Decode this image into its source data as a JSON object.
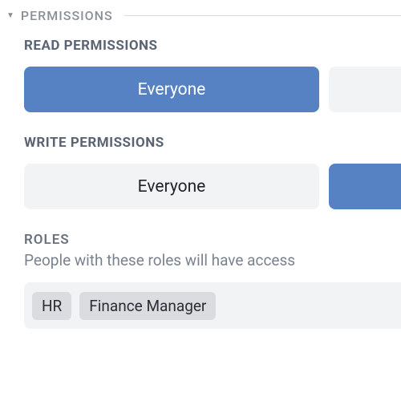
{
  "section": {
    "title": "PERMISSIONS"
  },
  "read": {
    "heading": "READ PERMISSIONS",
    "option_everyone": "Everyone"
  },
  "write": {
    "heading": "WRITE PERMISSIONS",
    "option_everyone": "Everyone"
  },
  "roles": {
    "heading": "ROLES",
    "description": "People with these roles will have access",
    "items": [
      "HR",
      "Finance Manager"
    ]
  }
}
